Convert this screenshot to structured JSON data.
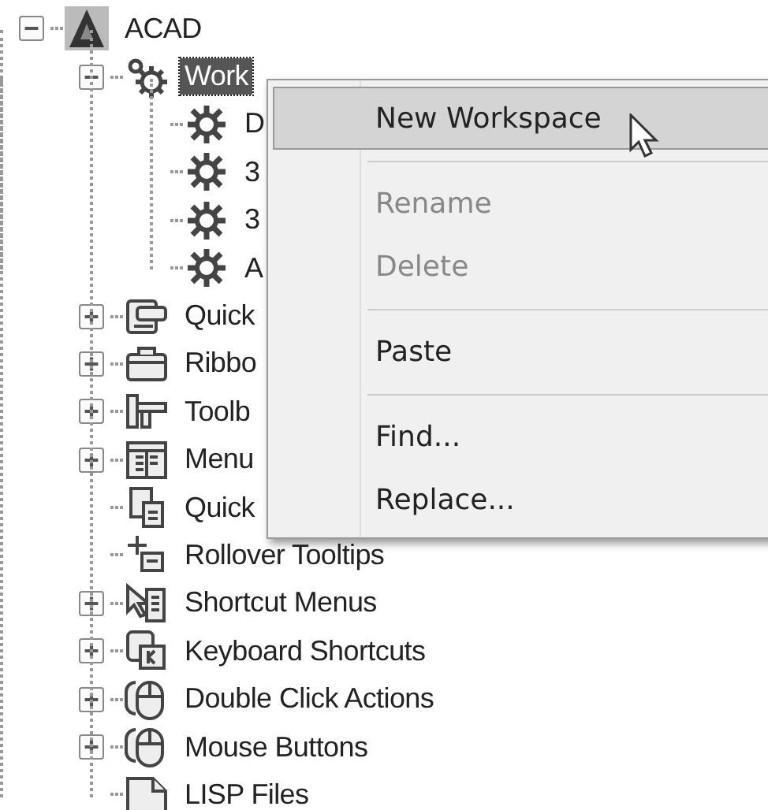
{
  "tree": [
    {
      "label": "ACAD",
      "kind": "app",
      "expanded": true,
      "selected": false,
      "children": [
        {
          "label": "Work",
          "kind": "gears",
          "expanded": true,
          "selected": true,
          "children": [
            {
              "label": "D",
              "kind": "gear",
              "selected": false
            },
            {
              "label": "3",
              "kind": "gear",
              "selected": false
            },
            {
              "label": "3",
              "kind": "gear",
              "selected": false
            },
            {
              "label": "A",
              "kind": "gear",
              "selected": false
            }
          ]
        },
        {
          "label": "Quick",
          "kind": "quick-access",
          "expanded": false,
          "selected": false
        },
        {
          "label": "Ribbo",
          "kind": "ribbon",
          "expanded": false,
          "selected": false
        },
        {
          "label": "Toolb",
          "kind": "toolbar",
          "expanded": false,
          "selected": false
        },
        {
          "label": "Menu",
          "kind": "menu",
          "expanded": false,
          "selected": false
        },
        {
          "label": "Quick",
          "kind": "properties",
          "selected": false
        },
        {
          "label": "Rollover Tooltips",
          "kind": "tooltip",
          "selected": false
        },
        {
          "label": "Shortcut Menus",
          "kind": "shortcut",
          "expanded": false,
          "selected": false
        },
        {
          "label": "Keyboard Shortcuts",
          "kind": "keyboard",
          "expanded": false,
          "selected": false
        },
        {
          "label": "Double Click Actions",
          "kind": "mouse",
          "expanded": false,
          "selected": false
        },
        {
          "label": "Mouse Buttons",
          "kind": "mouse",
          "expanded": false,
          "selected": false
        },
        {
          "label": "LISP Files",
          "kind": "file",
          "selected": false
        }
      ]
    }
  ],
  "context_menu": [
    {
      "kind": "item",
      "label": "New Workspace",
      "disabled": false,
      "selected": true
    },
    {
      "kind": "separator"
    },
    {
      "kind": "item",
      "label": "Rename",
      "disabled": true,
      "selected": false
    },
    {
      "kind": "item",
      "label": "Delete",
      "disabled": true,
      "selected": false
    },
    {
      "kind": "separator"
    },
    {
      "kind": "item",
      "label": "Paste",
      "disabled": false,
      "selected": false
    },
    {
      "kind": "separator"
    },
    {
      "kind": "item",
      "label": "Find...",
      "disabled": false,
      "selected": false
    },
    {
      "kind": "item",
      "label": "Replace...",
      "disabled": false,
      "selected": false
    }
  ]
}
